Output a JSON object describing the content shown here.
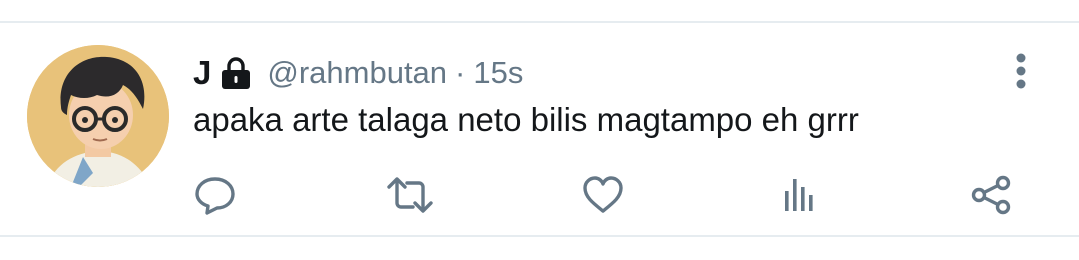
{
  "tweet": {
    "display_name": "J",
    "handle": "@rahmbutan",
    "separator": "·",
    "time": "15s",
    "text": "apaka arte talaga neto bilis magtampo eh grrr",
    "protected": true
  },
  "icons": {
    "lock": "lock-icon",
    "more": "more-vertical-icon",
    "reply": "reply-icon",
    "retweet": "retweet-icon",
    "like": "heart-icon",
    "analytics": "analytics-icon",
    "share": "share-icon"
  },
  "colors": {
    "text_primary": "#14171a",
    "text_secondary": "#657786",
    "action_icon": "#657786",
    "divider": "#e6ecf0"
  }
}
